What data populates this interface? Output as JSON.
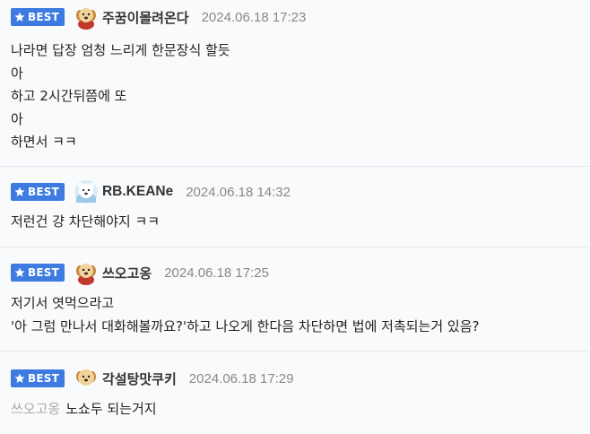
{
  "comments": [
    {
      "badge": "BEST",
      "avatar": "dog-avatar",
      "nickname": "주꿈이몰려온다",
      "timestamp": "2024.06.18 17:23",
      "lines": [
        "나라면 답장 엄청 느리게 한문장식 할듯",
        "아",
        "하고 2시간뒤쯤에 또",
        "아",
        "하면서 ㅋㅋ"
      ]
    },
    {
      "badge": "BEST",
      "avatar": "polar-bear-avatar",
      "nickname": "RB.KEANe",
      "timestamp": "2024.06.18 14:32",
      "lines": [
        "저런건 걍 차단해야지 ㅋㅋ"
      ]
    },
    {
      "badge": "BEST",
      "avatar": "dog-avatar",
      "nickname": "쓰오고옹",
      "timestamp": "2024.06.18 17:25",
      "lines": [
        "저기서 엿먹으라고",
        "'아 그럼 만나서 대화해볼까요?'하고 나오게 한다음 차단하면 법에 저촉되는거 있음?"
      ]
    },
    {
      "badge": "BEST",
      "avatar": "dog-avatar",
      "nickname": "각설탕맛쿠키",
      "timestamp": "2024.06.18 17:29",
      "mention": "쓰오고옹",
      "lines": [
        "노쇼두 되는거지"
      ]
    }
  ],
  "colors": {
    "badge_bg": "#3d7be0",
    "badge_text": "#ffffff",
    "timestamp": "#888888",
    "mention": "#aaaaaa",
    "row_bg": "#f9fafb",
    "divider": "#e6e8eb"
  }
}
